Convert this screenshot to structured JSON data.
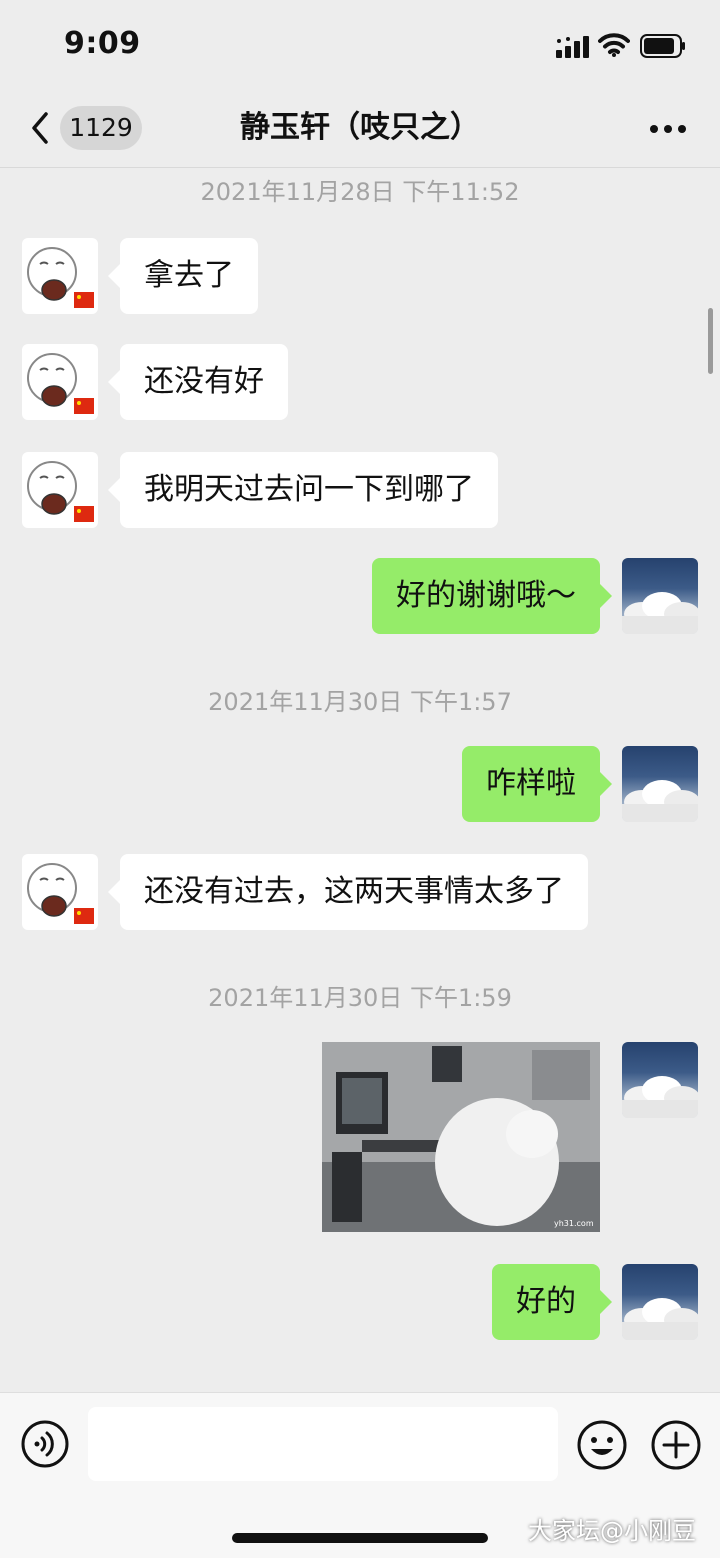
{
  "status_bar": {
    "time": "9:09"
  },
  "nav": {
    "unread_count": "1129",
    "title": "静玉轩（吱只之）"
  },
  "messages": {
    "ts1": "2021年11月28日 下午11:52",
    "m1": "拿去了",
    "m2": "还没有好",
    "m3": "我明天过去问一下到哪了",
    "m4": "好的谢谢哦～",
    "ts2": "2021年11月30日 下午1:57",
    "m5": "咋样啦",
    "m6": "还没有过去，这两天事情太多了",
    "ts3": "2021年11月30日 下午1:59",
    "image_caption": "yh31.com",
    "m7": "好的"
  },
  "input": {
    "placeholder": ""
  },
  "watermark": "大家坛@小刚豆",
  "colors": {
    "sent_bubble": "#95ec69",
    "received_bubble": "#ffffff",
    "background": "#ededed"
  },
  "icons": [
    "back-icon",
    "more-icon",
    "signal-icon",
    "wifi-icon",
    "battery-icon",
    "voice-icon",
    "emoji-icon",
    "plus-icon"
  ]
}
